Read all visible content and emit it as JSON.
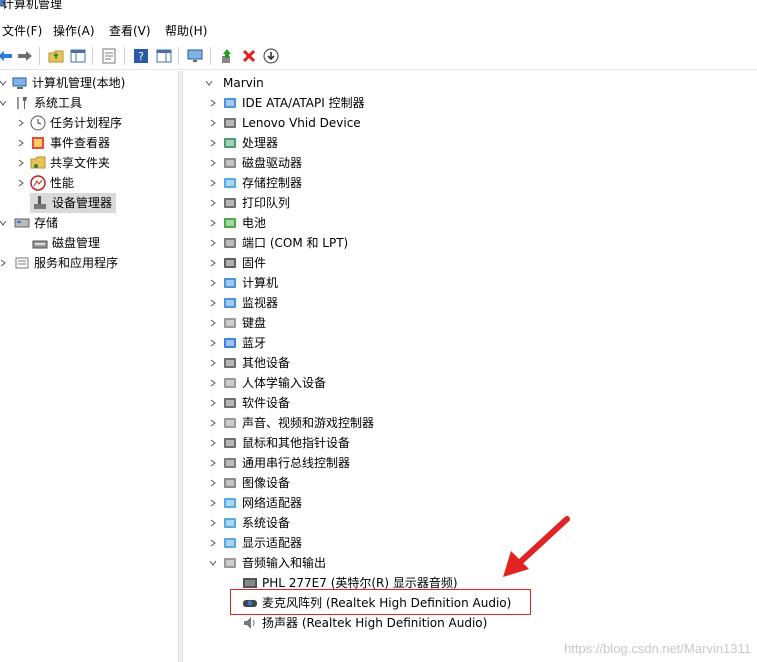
{
  "window": {
    "title": "计算机管理"
  },
  "menu": [
    "文件(F)",
    "操作(A)",
    "查看(V)",
    "帮助(H)"
  ],
  "left_tree": [
    {
      "label": "计算机管理(本地)"
    },
    {
      "label": "系统工具"
    },
    {
      "label": "任务计划程序"
    },
    {
      "label": "事件查看器"
    },
    {
      "label": "共享文件夹"
    },
    {
      "label": "性能"
    },
    {
      "label": "设备管理器"
    },
    {
      "label": "存储"
    },
    {
      "label": "磁盘管理"
    },
    {
      "label": "服务和应用程序"
    }
  ],
  "device_tree": {
    "root": "Marvin",
    "categories": [
      "IDE ATA/ATAPI 控制器",
      "Lenovo Vhid Device",
      "处理器",
      "磁盘驱动器",
      "存储控制器",
      "打印队列",
      "电池",
      "端口 (COM 和 LPT)",
      "固件",
      "计算机",
      "监视器",
      "键盘",
      "蓝牙",
      "其他设备",
      "人体学输入设备",
      "软件设备",
      "声音、视频和游戏控制器",
      "鼠标和其他指针设备",
      "通用串行总线控制器",
      "图像设备",
      "网络适配器",
      "系统设备",
      "显示适配器",
      "音频输入和输出"
    ],
    "audio_children": [
      "PHL 277E7 (英特尔(R) 显示器音频)",
      "麦克风阵列 (Realtek High Definition Audio)",
      "扬声器 (Realtek High Definition Audio)"
    ]
  },
  "watermark": "https://blog.csdn.net/Marvin1311"
}
